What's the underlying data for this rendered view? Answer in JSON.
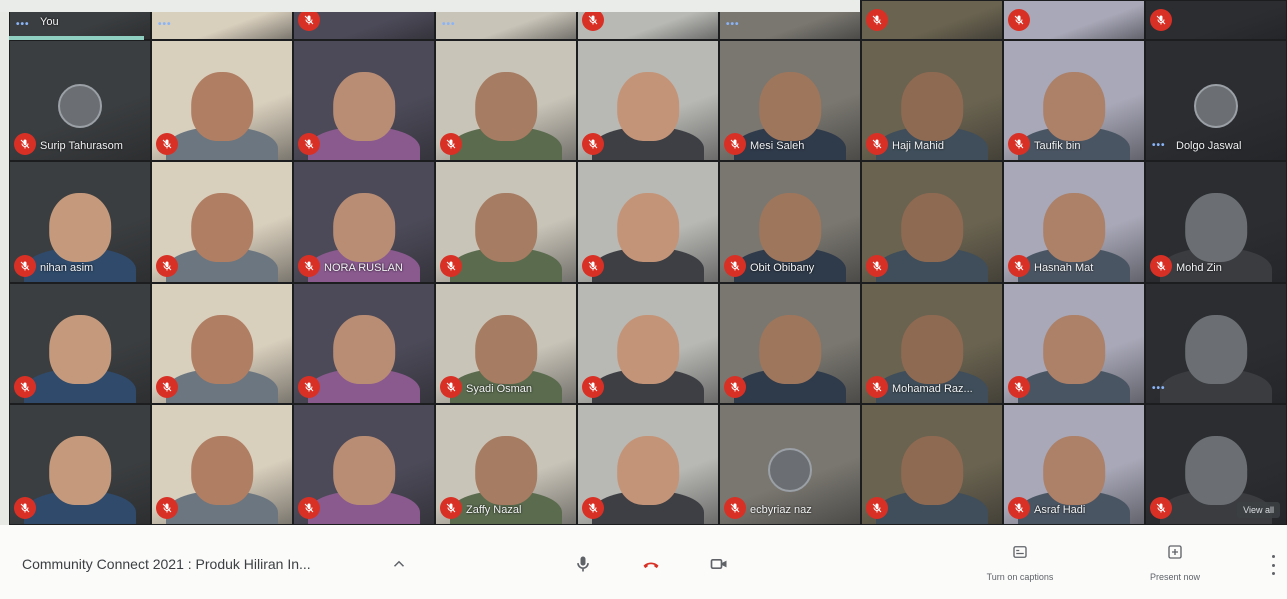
{
  "meeting": {
    "title": "Community Connect 2021 : Produk Hiliran In..."
  },
  "controls": {
    "mic_icon": "microphone-icon",
    "hangup_icon": "hangup-icon",
    "camera_icon": "camera-icon",
    "captions_label": "Turn on captions",
    "present_label": "Present now"
  },
  "more_view_label": "View all",
  "colors": {
    "accent": "#8ecfc2",
    "muted": "#d93025",
    "tile_bg": "#3c4043",
    "bar_bg": "#fbfbfa"
  },
  "participants": [
    {
      "name": "You",
      "indicator": "dots"
    },
    {
      "name": "",
      "indicator": "dots"
    },
    {
      "name": "",
      "indicator": "mic"
    },
    {
      "name": "",
      "indicator": "dots"
    },
    {
      "name": "",
      "indicator": "mic"
    },
    {
      "name": "",
      "indicator": "dots"
    },
    {
      "name": "",
      "indicator": "mic"
    },
    {
      "name": "",
      "indicator": "mic"
    },
    {
      "name": "",
      "indicator": "mic"
    },
    {
      "name": "Surip Tahurasom",
      "indicator": "mic"
    },
    {
      "name": "",
      "indicator": "mic"
    },
    {
      "name": "",
      "indicator": "mic"
    },
    {
      "name": "",
      "indicator": "mic"
    },
    {
      "name": "",
      "indicator": "mic"
    },
    {
      "name": "Mesi Saleh",
      "indicator": "mic"
    },
    {
      "name": "Haji Mahid",
      "indicator": "mic"
    },
    {
      "name": "Taufik bin",
      "indicator": "mic"
    },
    {
      "name": "Dolgo Jaswal",
      "indicator": "dots"
    },
    {
      "name": "nihan asim",
      "indicator": "mic"
    },
    {
      "name": "",
      "indicator": "mic"
    },
    {
      "name": "NORA RUSLAN",
      "indicator": "mic"
    },
    {
      "name": "",
      "indicator": "mic"
    },
    {
      "name": "",
      "indicator": "mic"
    },
    {
      "name": "Obit Obibany",
      "indicator": "mic"
    },
    {
      "name": "",
      "indicator": "mic"
    },
    {
      "name": "Hasnah Mat",
      "indicator": "mic"
    },
    {
      "name": "Mohd Zin",
      "indicator": "mic"
    },
    {
      "name": "",
      "indicator": "mic"
    },
    {
      "name": "",
      "indicator": "mic"
    },
    {
      "name": "",
      "indicator": "mic"
    },
    {
      "name": "Syadi Osman",
      "indicator": "mic"
    },
    {
      "name": "",
      "indicator": "mic"
    },
    {
      "name": "",
      "indicator": "mic"
    },
    {
      "name": "Mohamad Raz...",
      "indicator": "mic"
    },
    {
      "name": "",
      "indicator": "mic"
    },
    {
      "name": "",
      "indicator": "dots"
    },
    {
      "name": "",
      "indicator": "mic"
    },
    {
      "name": "",
      "indicator": "mic"
    },
    {
      "name": "",
      "indicator": "mic"
    },
    {
      "name": "Zaffy Nazal",
      "indicator": "mic"
    },
    {
      "name": "",
      "indicator": "mic"
    },
    {
      "name": "ecbyriaz naz",
      "indicator": "mic"
    },
    {
      "name": "",
      "indicator": "mic"
    },
    {
      "name": "Asraf Hadi",
      "indicator": "mic"
    },
    {
      "name": "",
      "indicator": "mic"
    }
  ]
}
